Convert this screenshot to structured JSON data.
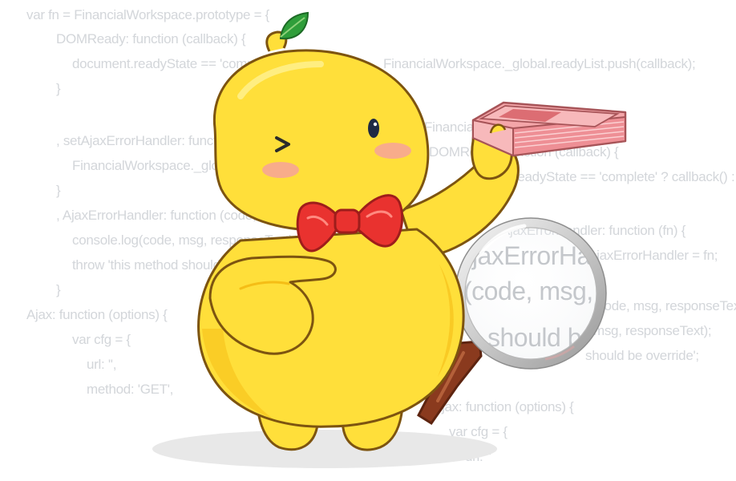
{
  "code_left": [
    "var fn = FinancialWorkspace.prototype = {",
    "DOMReady: function (callback) {",
    "document.readyState == 'complete' ? callback() :",
    "}",
    ", setAjaxErrorHandler: function (fn) {",
    "FinancialWorkspace._global.ajaxErrorHandler = fn;",
    "}",
    ", AjaxErrorHandler: function (code, msg, responseText) {",
    "console.log(code, msg, responseText);",
    "throw 'this method should be override';",
    "}",
    "Ajax: function (options) {",
    "var cfg = {",
    "url: '',",
    "method: 'GET',"
  ],
  "code_right": [
    "FinancialWorkspace._global.readyList.push(callback);",
    "= FinancialWorkspace.prototype = {",
    "DOMReady: function (callback) {",
    "readyState == 'complete' ? callback() :",
    "AjaxErrorHandler: function (fn) {",
    "ajaxErrorHandler = fn;",
    "(code, msg, responseText) {",
    "msg, responseText);",
    "should be override';",
    "Ajax: function (options) {",
    "var cfg = {",
    "url: ''"
  ],
  "code_magnified": [
    "AjaxErrorHandler: function (code",
    "(code, msg, responseText",
    "should be override"
  ],
  "icons": {
    "mascot": "yellow-chick-mascot-icon",
    "leaf": "leaf-sprout-icon",
    "bow_tie": "red-bow-tie-icon",
    "money": "money-stack-icon",
    "magnifier": "magnifying-glass-icon"
  },
  "colors": {
    "body": "#ffdf3a",
    "body_shadow": "#f5bd16",
    "outline": "#7d5410",
    "bow": "#e9322f",
    "leaf": "#2f9e3a",
    "money": "#f4a6a9",
    "code_text": "#d3d6da"
  }
}
